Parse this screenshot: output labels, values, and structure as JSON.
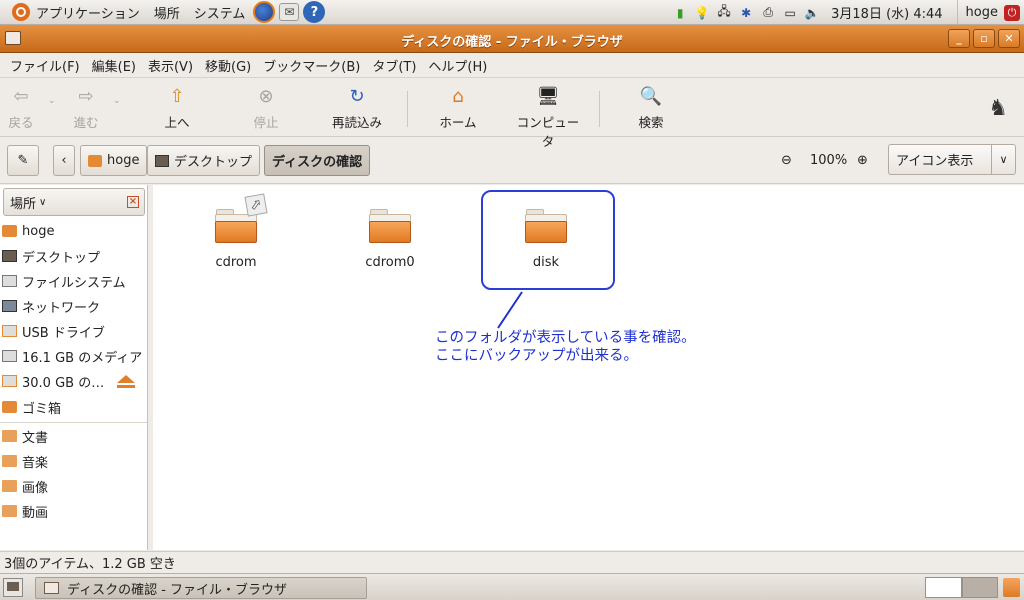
{
  "top_panel": {
    "menus": [
      "アプリケーション",
      "場所",
      "システム"
    ],
    "clock": "3月18日 (水) 4:44",
    "user": "hoge",
    "launchers": [
      "firefox-icon",
      "mail-icon",
      "help-icon"
    ]
  },
  "window": {
    "title": "ディスクの確認 - ファイル・ブラウザ",
    "controls": [
      "minimize",
      "maximize",
      "close"
    ]
  },
  "menubar": [
    "ファイル(F)",
    "編集(E)",
    "表示(V)",
    "移動(G)",
    "ブックマーク(B)",
    "タブ(T)",
    "ヘルプ(H)"
  ],
  "toolbar": {
    "back": "戻る",
    "forward": "進む",
    "up": "上へ",
    "stop": "停止",
    "reload": "再読込み",
    "home": "ホーム",
    "computer": "コンピュータ",
    "search": "検索"
  },
  "location": {
    "crumbs": [
      "hoge",
      "デスクトップ",
      "ディスクの確認"
    ],
    "active": "ディスクの確認",
    "zoom": "100%",
    "view_mode": "アイコン表示"
  },
  "sidebar": {
    "header": "場所",
    "places": [
      "hoge",
      "デスクトップ",
      "ファイルシステム",
      "ネットワーク",
      "USB ドライブ",
      "16.1 GB のメディア",
      "30.0 GB の…",
      "ゴミ箱"
    ],
    "bookmarks": [
      "文書",
      "音楽",
      "画像",
      "動画"
    ]
  },
  "files": [
    "cdrom",
    "cdrom0",
    "disk"
  ],
  "annotation": {
    "line1": "このフォルダが表示している事を確認。",
    "line2": "ここにバックアップが出来る。"
  },
  "status": "3個のアイテム、1.2 GB 空き",
  "taskbar": {
    "task_title": "ディスクの確認 - ファイル・ブラウザ"
  },
  "colors": {
    "titlebar": "#d97a26",
    "annotation": "#2030d0",
    "folder": "#e88a36"
  }
}
